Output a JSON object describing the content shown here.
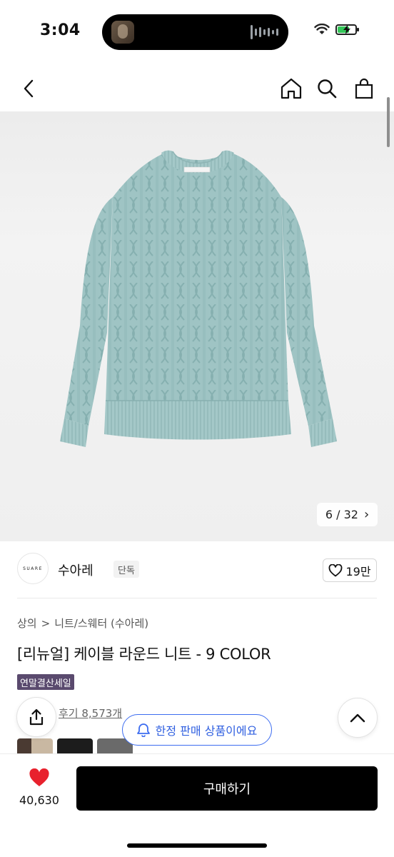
{
  "status_bar": {
    "time": "3:04"
  },
  "nav": {
    "back": "back-icon",
    "home": "home-icon",
    "search": "search-icon",
    "cart": "shopping-bag-icon"
  },
  "gallery": {
    "current": "6",
    "separator": "/",
    "total": "32",
    "next": "›"
  },
  "brand": {
    "logo_text": "SUARE",
    "name": "수아레",
    "badge": "단독",
    "likes": "19만"
  },
  "breadcrumb": {
    "category": "상의",
    "separator": ">",
    "subcategory": "니트/스웨터 (수아레)"
  },
  "product": {
    "title": "[리뉴얼] 케이블 라운드 니트 - 9 COLOR",
    "sale_tag": "연말결산세일",
    "review_link": "후기 8,573개"
  },
  "toast": {
    "text": "한정 판매 상품이에요"
  },
  "bottom_bar": {
    "wish_count": "40,630",
    "buy_label": "구매하기"
  },
  "colors": {
    "accent_blue": "#3d6df0",
    "sale_tag": "#5a4a6e",
    "heart": "#e8212d",
    "sweater": "#9fc4c4"
  }
}
